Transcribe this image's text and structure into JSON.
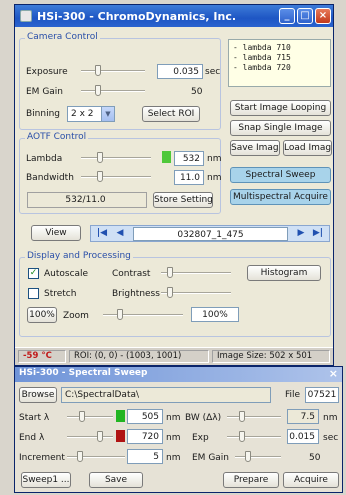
{
  "main_window": {
    "title": "HSi-300 - ChromoDynamics, Inc.",
    "camera_control": {
      "title": "Camera Control",
      "exposure_label": "Exposure",
      "exposure_value": "0.035",
      "exposure_unit": "sec",
      "em_gain_label": "EM Gain",
      "em_gain_value": "50",
      "binning_label": "Binning",
      "binning_value": "2 x 2",
      "select_roi_label": "Select ROI"
    },
    "log_lines": [
      "- lambda 710",
      "- lambda 715",
      "- lambda 720"
    ],
    "buttons": {
      "start_looping": "Start Image Looping",
      "snap_single": "Snap Single Image",
      "save_image": "Save Image",
      "load_image": "Load Image",
      "spectral_sweep": "Spectral Sweep",
      "multispectral_acquire": "Multispectral Acquire"
    },
    "aotf_control": {
      "title": "AOTF Control",
      "lambda_label": "Lambda",
      "lambda_value": "532",
      "lambda_unit": "nm",
      "lambda_color": "#4fc83a",
      "bandwidth_label": "Bandwidth",
      "bandwidth_value": "11.0",
      "bandwidth_unit": "nm",
      "setting_display": "532/11.0",
      "store_setting_label": "Store Setting"
    },
    "view_button": "View",
    "nav": {
      "first": "|◀",
      "prev": "◀",
      "filename": "032807_1_475",
      "next": "▶",
      "last": "▶|"
    },
    "display": {
      "title": "Display and Processing",
      "autoscale_label": "Autoscale",
      "autoscale_checked": true,
      "contrast_label": "Contrast",
      "histogram_label": "Histogram",
      "stretch_label": "Stretch",
      "stretch_checked": false,
      "brightness_label": "Brightness",
      "zoom_preset": "100%",
      "zoom_label": "Zoom",
      "zoom_value": "100%"
    },
    "status": {
      "temperature": "-59 °C",
      "roi": "ROI: (0, 0) - (1003, 1001)",
      "image_size": "Image Size: 502 x 501"
    }
  },
  "sweep_window": {
    "title": "HSi-300 - Spectral Sweep",
    "browse_label": "Browse",
    "path": "C:\\SpectralData\\",
    "file_label": "File",
    "file_value": "07521",
    "start_label": "Start λ",
    "start_value": "505",
    "start_color": "#22b522",
    "end_label": "End λ",
    "end_value": "720",
    "end_color": "#b01313",
    "increment_label": "Increment",
    "increment_value": "5",
    "nm_unit": "nm",
    "bw_label": "BW (Δλ)",
    "bw_value": "7.5",
    "bw_unit": "nm",
    "exp_label": "Exp",
    "exp_value": "0.015",
    "exp_unit": "sec",
    "em_gain_label": "EM Gain",
    "em_gain_value": "50",
    "sweep_button": "Sweep1 ...",
    "save_button": "Save",
    "prepare_button": "Prepare",
    "acquire_button": "Acquire",
    "close_glyph": "×"
  }
}
